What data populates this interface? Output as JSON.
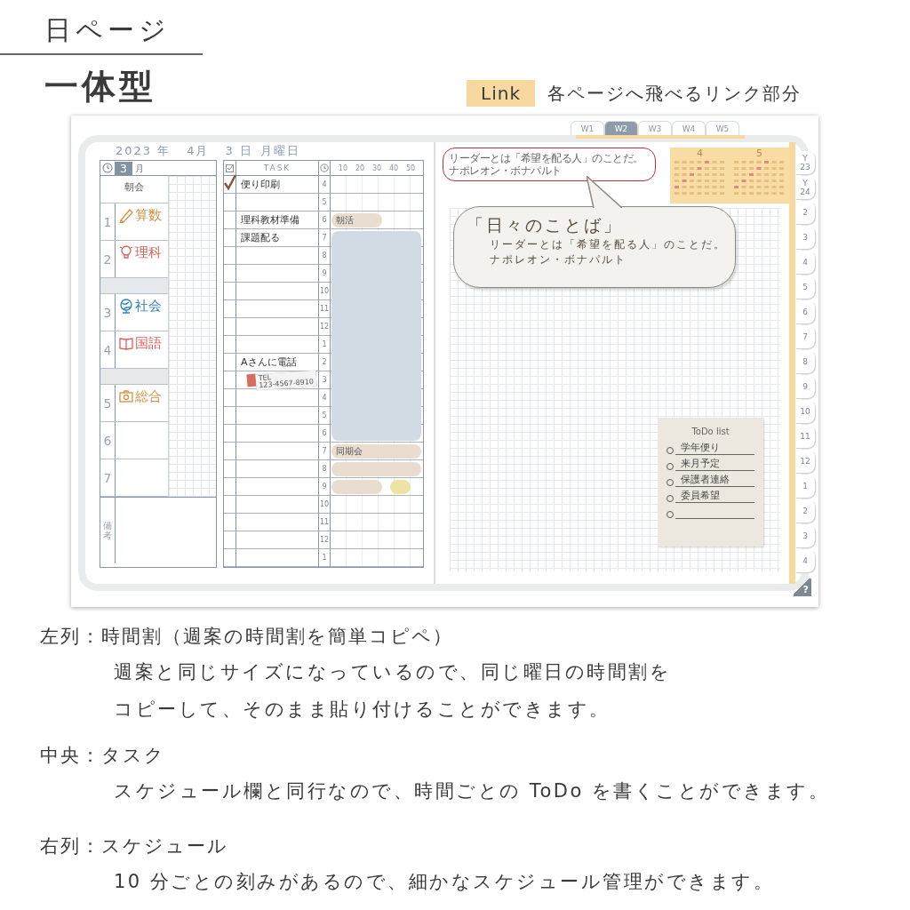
{
  "header": {
    "title": "日ページ",
    "subtitle": "一体型"
  },
  "link_legend": {
    "badge": "Link",
    "text": "各ページへ飛べるリンク部分"
  },
  "planner": {
    "week_tabs": [
      {
        "label": "W1",
        "selected": false
      },
      {
        "label": "W2",
        "selected": true
      },
      {
        "label": "W3",
        "selected": false
      },
      {
        "label": "W4",
        "selected": false
      },
      {
        "label": "W5",
        "selected": false
      }
    ],
    "date": {
      "year": "2023 年",
      "month": "4月",
      "day": "3 日",
      "weekday": "月曜日"
    },
    "timetable": {
      "day": "3",
      "day_label": "月",
      "rows": [
        {
          "kind": "assembly",
          "label": "朝会"
        },
        {
          "kind": "period",
          "number": "1",
          "subject": "算数",
          "color": "#d39243"
        },
        {
          "kind": "period",
          "number": "2",
          "subject": "理科",
          "color": "#d9605a"
        },
        {
          "kind": "break"
        },
        {
          "kind": "period",
          "number": "3",
          "subject": "社会",
          "color": "#2f7fc4"
        },
        {
          "kind": "period",
          "number": "4",
          "subject": "国語",
          "color": "#d9605a"
        },
        {
          "kind": "break"
        },
        {
          "kind": "period",
          "number": "5",
          "subject": "総合",
          "color": "#d39243"
        },
        {
          "kind": "period",
          "number": "6"
        },
        {
          "kind": "period",
          "number": "7"
        }
      ],
      "notes_label": "備考"
    },
    "tasks": {
      "header": "TASK",
      "minute_ticks": [
        "10",
        "20",
        "30",
        "40",
        "50"
      ],
      "rows": [
        {
          "hour": "4",
          "kind": "task",
          "text": "便り印刷",
          "checked": true
        },
        {
          "hour": "5",
          "kind": "task",
          "checked": false
        },
        {
          "hour": "6",
          "kind": "task",
          "text": "理科教材準備",
          "checked": false,
          "schedule": [
            {
              "kind": "half",
              "label": "朝活",
              "color": "#e9ddd0"
            }
          ]
        },
        {
          "hour": "7",
          "kind": "task",
          "text": "課題配る",
          "checked": false,
          "schedule": [
            {
              "kind": "span",
              "color": "#d2dae4"
            }
          ]
        },
        {
          "hour": "8",
          "kind": "task",
          "checked": false,
          "schedule": [
            {
              "kind": "span",
              "color": "#d2dae4"
            }
          ]
        },
        {
          "hour": "9",
          "kind": "task",
          "checked": false,
          "schedule": [
            {
              "kind": "span",
              "color": "#d2dae4"
            }
          ]
        },
        {
          "hour": "10",
          "kind": "task",
          "checked": false,
          "schedule": [
            {
              "kind": "span",
              "color": "#d2dae4"
            }
          ]
        },
        {
          "hour": "11",
          "kind": "task",
          "checked": false,
          "schedule": [
            {
              "kind": "span",
              "color": "#d2dae4"
            }
          ]
        },
        {
          "hour": "12",
          "kind": "task",
          "checked": false,
          "schedule": [
            {
              "kind": "span",
              "color": "#d2dae4"
            }
          ]
        },
        {
          "hour": "1",
          "kind": "task",
          "checked": false,
          "schedule": [
            {
              "kind": "span",
              "color": "#d2dae4"
            }
          ]
        },
        {
          "hour": "2",
          "kind": "task",
          "text": "Aさんに電話",
          "checked": false,
          "schedule": [
            {
              "kind": "span",
              "color": "#d2dae4"
            }
          ]
        },
        {
          "hour": "3",
          "kind": "sticker",
          "label": "TEL",
          "text": "123-4567-8910",
          "checked": false,
          "schedule": [
            {
              "kind": "span",
              "color": "#d2dae4"
            }
          ]
        },
        {
          "hour": "4",
          "kind": "task",
          "checked": false,
          "schedule": [
            {
              "kind": "span",
              "color": "#d2dae4"
            }
          ]
        },
        {
          "hour": "5",
          "kind": "task",
          "checked": false,
          "schedule": [
            {
              "kind": "span",
              "color": "#d2dae4"
            }
          ]
        },
        {
          "hour": "6",
          "kind": "task",
          "checked": false,
          "schedule": [
            {
              "kind": "span",
              "color": "#d2dae4"
            }
          ]
        },
        {
          "hour": "7",
          "kind": "task",
          "checked": false,
          "schedule": [
            {
              "kind": "full",
              "label": "同期会",
              "color": "#e9ddd0"
            }
          ]
        },
        {
          "hour": "8",
          "kind": "task",
          "checked": false,
          "schedule": [
            {
              "kind": "full",
              "color": "#e9ddd0"
            }
          ]
        },
        {
          "hour": "9",
          "kind": "task",
          "checked": false,
          "schedule": [
            {
              "kind": "half",
              "color": "#e9ddd0"
            },
            {
              "kind": "quarter",
              "color": "#ece3a5"
            }
          ]
        },
        {
          "hour": "10",
          "kind": "task",
          "checked": false
        },
        {
          "hour": "11",
          "kind": "task",
          "checked": false
        },
        {
          "hour": "12",
          "kind": "task",
          "checked": false
        },
        {
          "hour": "1",
          "kind": "task",
          "checked": false
        }
      ]
    },
    "memo": {
      "lines": [
        "リーダーとは「希望を配る人」のことだ。",
        "ナポレオン・ボナパルト"
      ]
    },
    "calendar": {
      "months": [
        "4",
        "5"
      ]
    },
    "quote": {
      "title": "「日々のことば」",
      "lines": [
        "リーダーとは「希望を配る人」のことだ。",
        "ナポレオン・ボナパルト"
      ]
    },
    "todo": {
      "title": "ToDo list",
      "items": [
        "学年便り",
        "来月予定",
        "保護者連絡",
        "委員希望"
      ]
    },
    "side_tabs": [
      "Y\n23",
      "Y\n24",
      "2",
      "3",
      "4",
      "5",
      "6",
      "7",
      "8",
      "9",
      "10",
      "11",
      "12",
      "1",
      "2",
      "3",
      "4"
    ],
    "help_mark": "?"
  },
  "notes": [
    {
      "heading": "左列：時間割（週案の時間割を簡単コピペ）",
      "lines": [
        "週案と同じサイズになっているので、同じ曜日の時間割を",
        "コピーして、そのまま貼り付けることができます。"
      ]
    },
    {
      "heading": "中央：タスク",
      "lines": [
        "スケジュール欄と同行なので、時間ごとの ToDo を書くことができます。"
      ]
    },
    {
      "heading": "右列：スケジュール",
      "lines": [
        "10 分ごとの刻みがあるので、細かなスケジュール管理ができます。"
      ]
    }
  ]
}
